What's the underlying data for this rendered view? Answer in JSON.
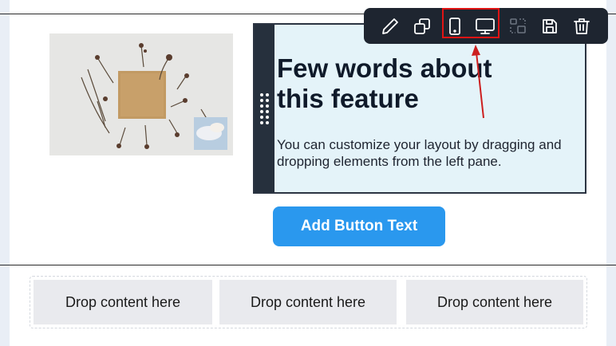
{
  "feature": {
    "title": "Few words about this feature",
    "body": "You can customize your layout by dragging and dropping elements from the left pane."
  },
  "button": {
    "label": "Add Button Text",
    "color": "#2a98ee"
  },
  "toolbar": {
    "tools": [
      {
        "name": "edit",
        "icon": "pencil-icon"
      },
      {
        "name": "duplicate",
        "icon": "copy-icon"
      },
      {
        "name": "mobile-view",
        "icon": "mobile-icon",
        "highlighted": true
      },
      {
        "name": "desktop-view",
        "icon": "monitor-icon",
        "highlighted": true
      },
      {
        "name": "select-parent",
        "icon": "select-parent-icon",
        "disabled": true
      },
      {
        "name": "save",
        "icon": "save-icon"
      },
      {
        "name": "delete",
        "icon": "trash-icon"
      }
    ],
    "highlight_color": "#e01414"
  },
  "drop_zones": [
    {
      "label": "Drop content here"
    },
    {
      "label": "Drop content here"
    },
    {
      "label": "Drop content here"
    }
  ]
}
